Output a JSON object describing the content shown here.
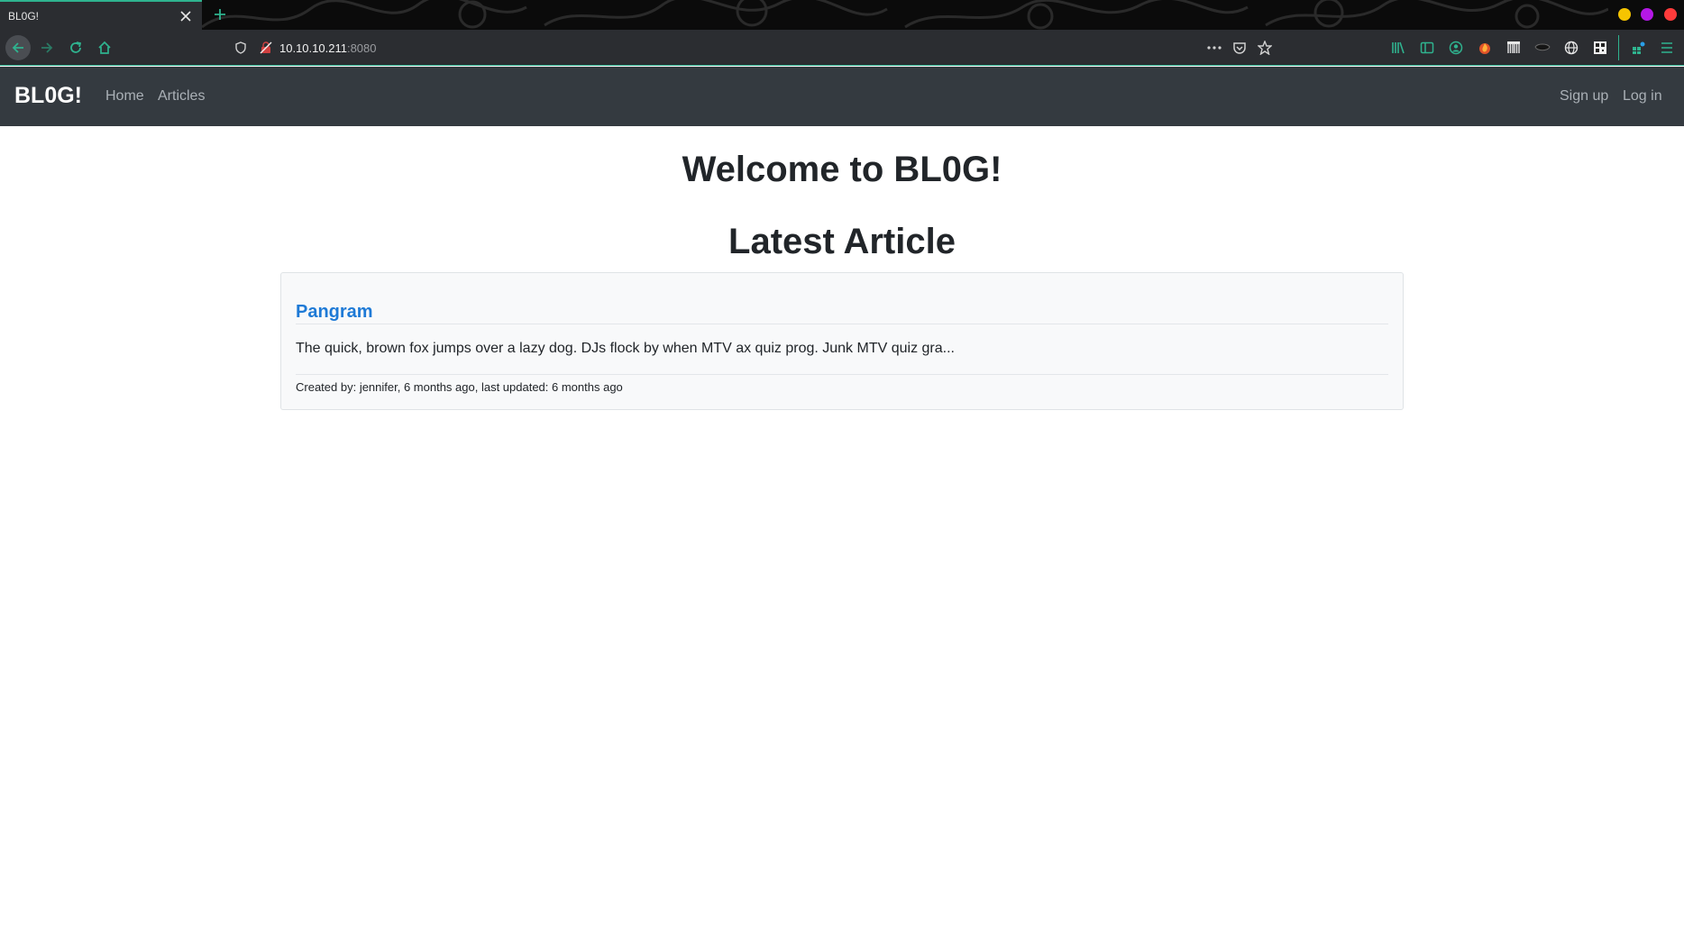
{
  "browser": {
    "tab_title": "BL0G!",
    "url_host": "10.10.10.211",
    "url_port": ":8080",
    "accent_color": "#2fb38f",
    "window_controls": [
      {
        "name": "minimize",
        "color": "#f5c400"
      },
      {
        "name": "maximize",
        "color": "#b418e6"
      },
      {
        "name": "close",
        "color": "#ff3b3b"
      }
    ],
    "toolbar_icons": [
      "library-icon",
      "sidebar-icon",
      "account-icon",
      "extension-fire-icon",
      "extension-barcode-icon",
      "extension-mask-icon",
      "extension-globe-icon",
      "extension-qr-icon",
      "extensions-icon",
      "menu-icon"
    ]
  },
  "site": {
    "brand": "BL0G!",
    "nav_left": [
      "Home",
      "Articles"
    ],
    "nav_right": [
      "Sign up",
      "Log in"
    ]
  },
  "main": {
    "welcome": "Welcome to BL0G!",
    "latest_heading": "Latest Article",
    "article": {
      "title": "Pangram",
      "excerpt": "The quick, brown fox jumps over a lazy dog. DJs flock by when MTV ax quiz prog. Junk MTV quiz gra...",
      "meta": "Created by: jennifer, 6 months ago, last updated: 6 months ago"
    }
  }
}
